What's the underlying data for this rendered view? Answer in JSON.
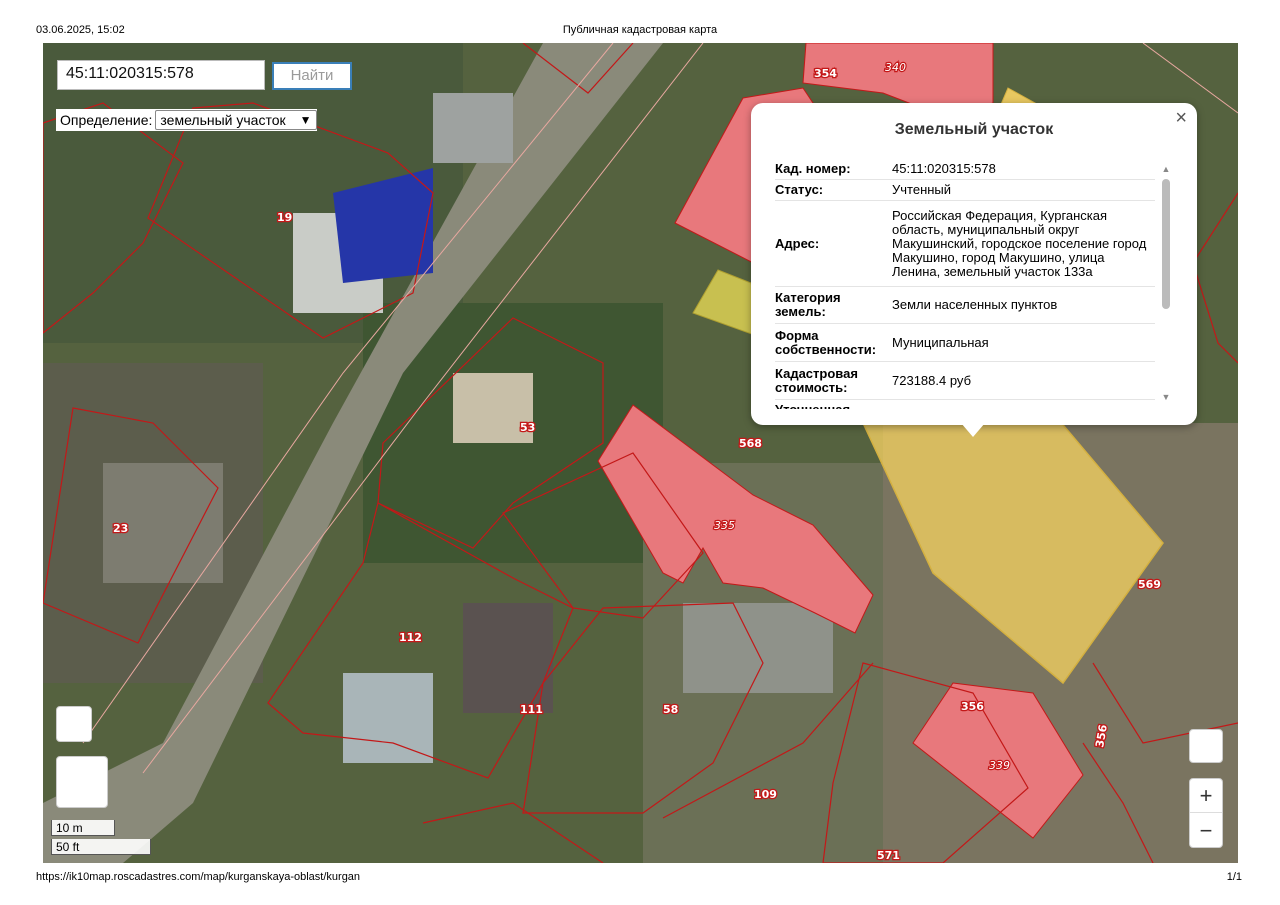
{
  "print": {
    "datetime": "03.06.2025, 15:02",
    "page_title": "Публичная кадастровая карта",
    "url": "https://ik10map.roscadastres.com/map/kurganskaya-oblast/kurgan",
    "pages": "1/1"
  },
  "search": {
    "value": "45:11:020315:578",
    "button": "Найти"
  },
  "definition": {
    "label": "Определение:",
    "selected": "земельный участок"
  },
  "popup": {
    "title": "Земельный участок",
    "close": "×",
    "rows": [
      {
        "key": "Кад. номер:",
        "value": "45:11:020315:578"
      },
      {
        "key": "Статус:",
        "value": "Учтенный"
      },
      {
        "key": "Адрес:",
        "value": "Российская Федерация, Курганская область, муниципальный округ Макушинский, городское поселение город Макушино, город Макушино, улица Ленина, земельный участок 133а"
      },
      {
        "key": "Категория земель:",
        "value": "Земли населенных пунктов"
      },
      {
        "key": "Форма собственности:",
        "value": "Муниципальная"
      },
      {
        "key": "Кадастровая стоимость:",
        "value": "723188.4 руб"
      }
    ],
    "truncated_row_key": "Уточненная"
  },
  "map_labels": [
    "354",
    "340",
    "19",
    "53",
    "568",
    "335",
    "23",
    "569",
    "112",
    "111",
    "58",
    "356",
    "339",
    "356",
    "109",
    "571"
  ],
  "zoom": {
    "in": "+",
    "out": "−"
  },
  "scale": {
    "meters": "10 m",
    "feet": "50 ft"
  },
  "colors": {
    "parcel_red": "#e8787c",
    "parcel_yellow": "#e8c860",
    "boundary": "#c31818",
    "road": "#8a8a7a"
  }
}
